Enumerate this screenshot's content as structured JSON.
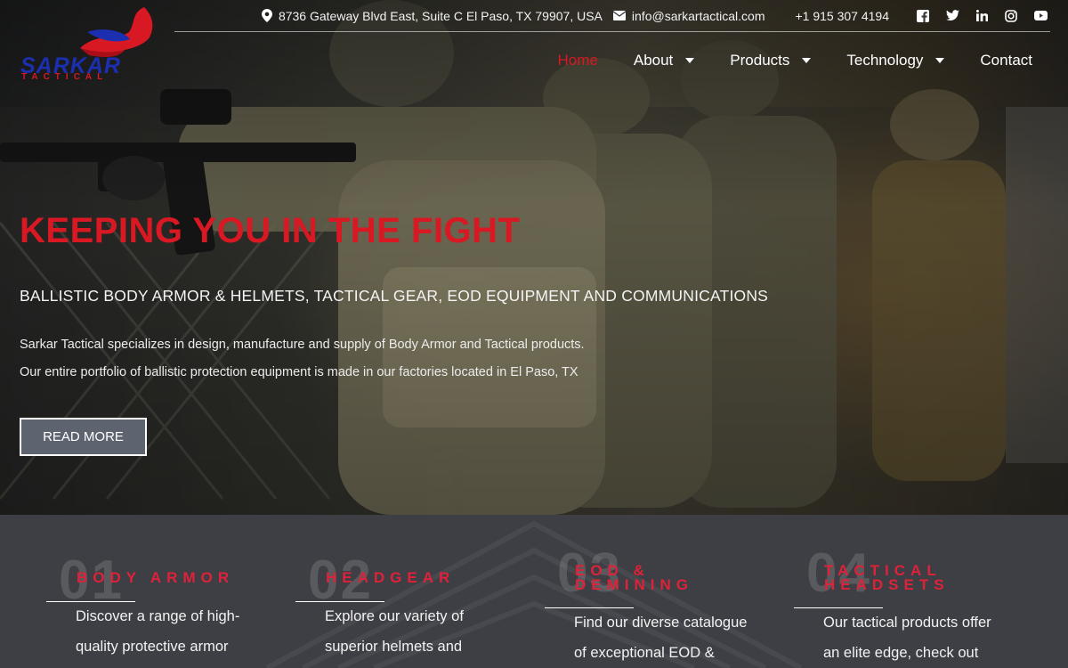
{
  "topbar": {
    "address": "8736 Gateway Blvd East, Suite C El Paso, TX 79907, USA",
    "email": "info@sarkartactical.com",
    "phone": "+1 915 307 4194",
    "socials": [
      "facebook-icon",
      "twitter-icon",
      "linkedin-icon",
      "instagram-icon",
      "youtube-icon"
    ]
  },
  "logo": {
    "word": "SARKAR",
    "sub": "TACTICAL"
  },
  "nav": {
    "items": [
      {
        "label": "Home",
        "active": true,
        "dropdown": false
      },
      {
        "label": "About",
        "active": false,
        "dropdown": true
      },
      {
        "label": "Products",
        "active": false,
        "dropdown": true
      },
      {
        "label": "Technology",
        "active": false,
        "dropdown": true
      },
      {
        "label": "Contact",
        "active": false,
        "dropdown": false
      }
    ]
  },
  "hero": {
    "headline": "KEEPING YOU IN THE FIGHT",
    "subhead": "BALLISTIC BODY ARMOR & HELMETS, TACTICAL GEAR, EOD EQUIPMENT AND COMMUNICATIONS",
    "para1": "Sarkar Tactical specializes in design, manufacture and supply of Body Armor and Tactical products.",
    "para2": "Our entire portfolio of ballistic protection equipment is made in our factories located in El Paso, TX",
    "button": "READ MORE"
  },
  "features": [
    {
      "num": "01",
      "title_line1": "BODY ARMOR",
      "title_line2": "",
      "line1": "Discover a range of high-",
      "line2": "quality protective armor"
    },
    {
      "num": "02",
      "title_line1": "HEADGEAR",
      "title_line2": "",
      "line1": "Explore our variety of",
      "line2": "superior helmets and"
    },
    {
      "num": "03",
      "title_line1": "EOD &",
      "title_line2": "DEMINING",
      "line1": "Find our diverse catalogue",
      "line2": "of exceptional EOD &"
    },
    {
      "num": "04",
      "title_line1": "TACTICAL",
      "title_line2": "HEADSETS",
      "line1": "Our tactical products offer",
      "line2": "an elite edge, check out"
    }
  ],
  "colors": {
    "accent": "#d81822",
    "logo_blue": "#1b2fb0",
    "button_bg": "#5d6470",
    "section_bg": "#3d3f44"
  }
}
